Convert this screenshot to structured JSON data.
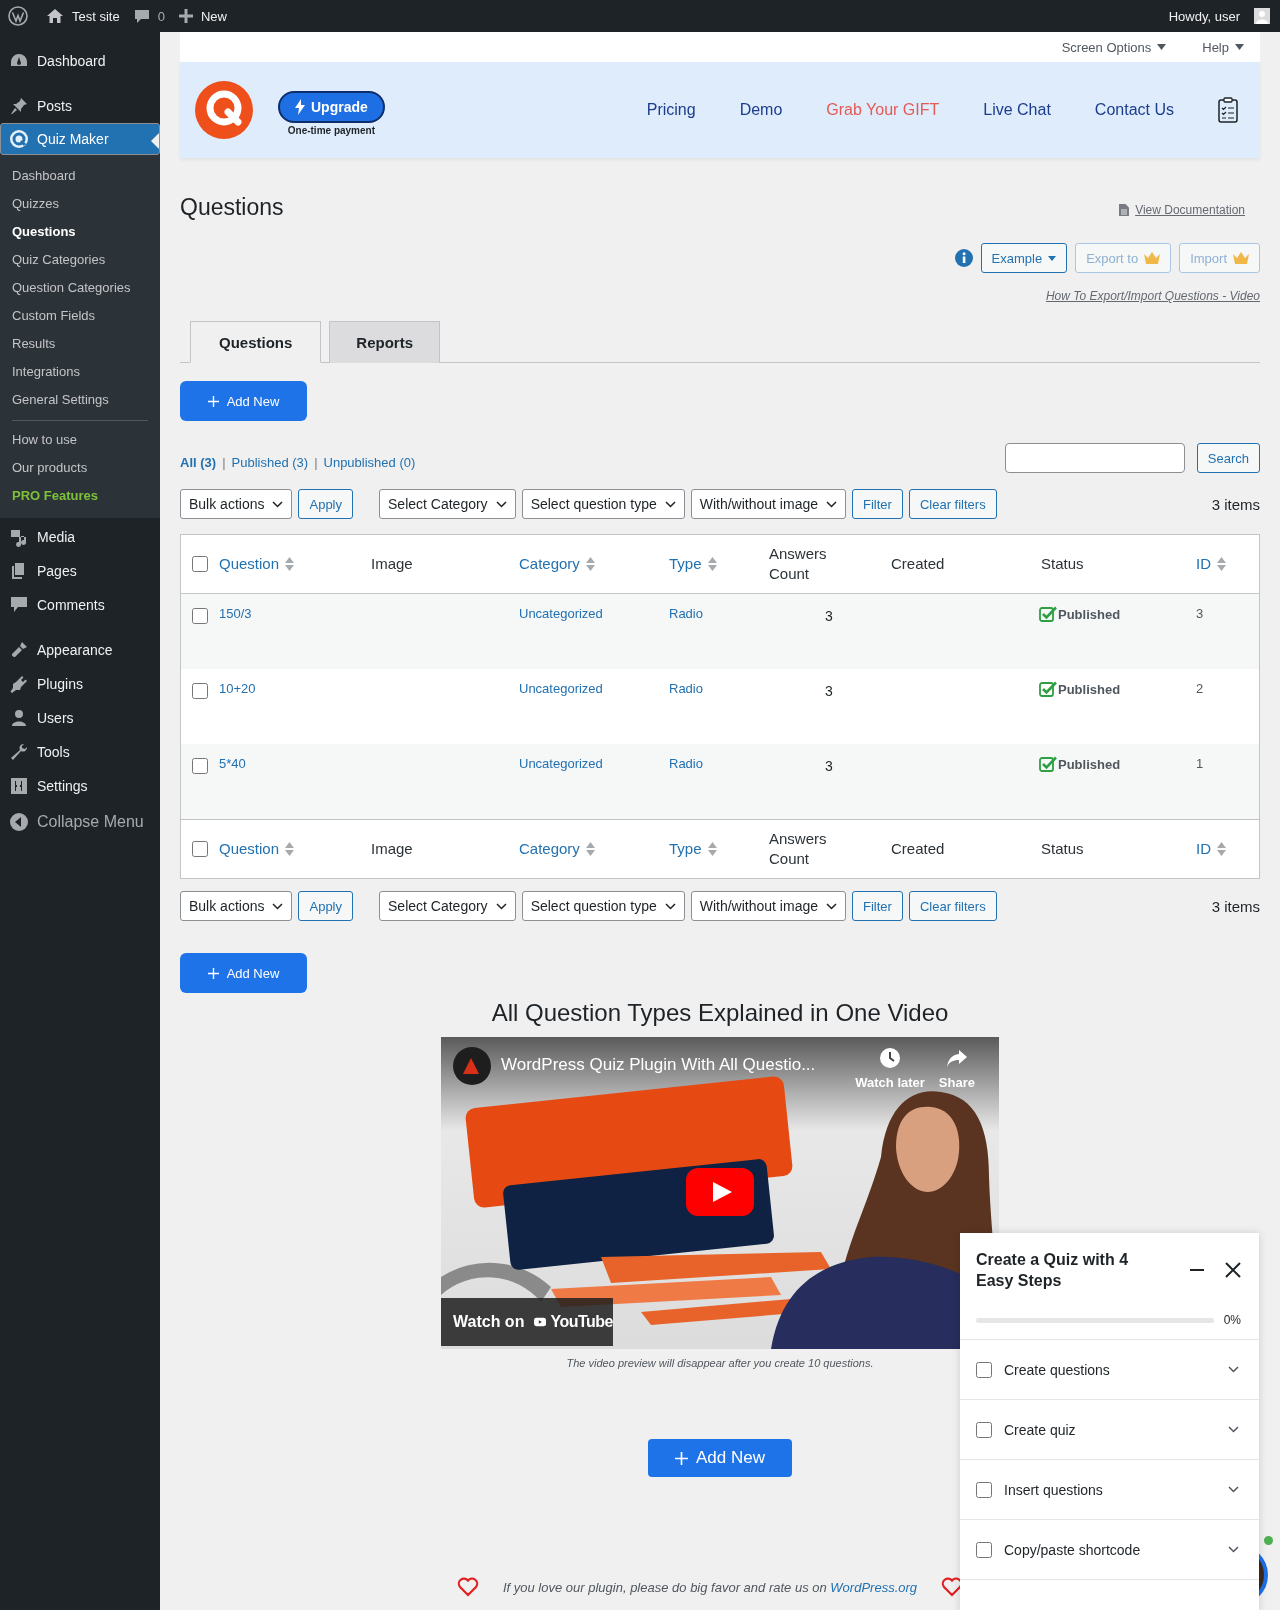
{
  "admin_bar": {
    "site": "Test site",
    "comments": "0",
    "new": "New",
    "greeting": "Howdy, user"
  },
  "sidebar": {
    "top": [
      {
        "label": "Dashboard",
        "selected": false
      },
      {
        "label": "Posts",
        "selected": false
      },
      {
        "label": "Quiz Maker",
        "selected": true
      }
    ],
    "submenu_groups": [
      {
        "items": [
          {
            "label": "Dashboard",
            "selected": false,
            "kind": "link"
          },
          {
            "label": "Quizzes",
            "selected": false,
            "kind": "link"
          },
          {
            "label": "Questions",
            "selected": true,
            "kind": "link"
          },
          {
            "label": "Quiz Categories",
            "selected": false,
            "kind": "link"
          },
          {
            "label": "Question Categories",
            "selected": false,
            "kind": "link"
          },
          {
            "label": "Custom Fields",
            "selected": false,
            "kind": "link"
          },
          {
            "label": "Results",
            "selected": false,
            "kind": "link"
          },
          {
            "label": "Integrations",
            "selected": false,
            "kind": "link"
          },
          {
            "label": "General Settings",
            "selected": false,
            "kind": "link"
          }
        ]
      },
      {
        "items": [
          {
            "label": "How to use",
            "selected": false,
            "kind": "link"
          },
          {
            "label": "Our products",
            "selected": false,
            "kind": "link"
          },
          {
            "label": "PRO Features",
            "selected": false,
            "kind": "pro"
          }
        ]
      }
    ],
    "bottom": [
      {
        "label": "Media",
        "selected": false
      },
      {
        "label": "Pages",
        "selected": false
      },
      {
        "label": "Comments",
        "selected": false
      },
      {
        "label": "Appearance",
        "selected": false
      },
      {
        "label": "Plugins",
        "selected": false
      },
      {
        "label": "Users",
        "selected": false
      },
      {
        "label": "Tools",
        "selected": false
      },
      {
        "label": "Settings",
        "selected": false
      }
    ],
    "collapse": "Collapse Menu"
  },
  "screen_meta": [
    "Screen Options",
    "Help"
  ],
  "banner": {
    "upgrade": "Upgrade",
    "upgrade_note": "One-time payment",
    "nav": [
      {
        "label": "Pricing",
        "kind": "normal"
      },
      {
        "label": "Demo",
        "kind": "normal"
      },
      {
        "label": "Grab Your GIFT",
        "kind": "promo"
      },
      {
        "label": "Live Chat",
        "kind": "normal"
      },
      {
        "label": "Contact Us",
        "kind": "normal"
      }
    ]
  },
  "page": {
    "title": "Questions",
    "doc_link": "View Documentation",
    "actions": [
      {
        "label": "Example",
        "kind": "dropdown"
      },
      {
        "label": "Export to",
        "kind": "pro"
      },
      {
        "label": "Import",
        "kind": "pro"
      }
    ],
    "video_link": "How To Export/Import Questions - Video"
  },
  "tabs": [
    {
      "label": "Questions",
      "selected": true
    },
    {
      "label": "Reports",
      "selected": false
    }
  ],
  "add_new_top": "Add New",
  "views": [
    {
      "label": "All (3)",
      "selected": true
    },
    {
      "separator": "|",
      "label": "Published (3)",
      "selected": false
    },
    {
      "separator": "|",
      "label": "Unpublished (0)",
      "selected": false
    }
  ],
  "search": {
    "button": "Search"
  },
  "toolbar_top": {
    "bulk": "Bulk actions",
    "apply": "Apply",
    "filters": [
      "Select Category",
      "Select question type",
      "With/without image"
    ],
    "filter": "Filter",
    "clear": "Clear filters",
    "count": "3 items"
  },
  "table": {
    "select_all_checked": false,
    "columns": [
      {
        "label": "Question",
        "sortable": true
      },
      {
        "label": "Image",
        "sortable": false
      },
      {
        "label": "Category",
        "sortable": true
      },
      {
        "label": "Type",
        "sortable": true
      },
      {
        "label": "Answers Count",
        "sortable": false
      },
      {
        "label": "Created",
        "sortable": false
      },
      {
        "label": "Status",
        "sortable": false
      },
      {
        "label": "ID",
        "sortable": true
      }
    ],
    "rows": [
      {
        "question": "150/3",
        "category": "Uncategorized",
        "type": "Radio",
        "answers": "3",
        "status": "Published",
        "id": "3",
        "checked": false
      },
      {
        "question": "10+20",
        "category": "Uncategorized",
        "type": "Radio",
        "answers": "3",
        "status": "Published",
        "id": "2",
        "checked": false
      },
      {
        "question": "5*40",
        "category": "Uncategorized",
        "type": "Radio",
        "answers": "3",
        "status": "Published",
        "id": "1",
        "checked": false
      }
    ],
    "footer_select_all_checked": false,
    "footer_columns": [
      {
        "label": "Question",
        "sortable": true
      },
      {
        "label": "Image",
        "sortable": false
      },
      {
        "label": "Category",
        "sortable": true
      },
      {
        "label": "Type",
        "sortable": true
      },
      {
        "label": "Answers Count",
        "sortable": false
      },
      {
        "label": "Created",
        "sortable": false
      },
      {
        "label": "Status",
        "sortable": false
      },
      {
        "label": "ID",
        "sortable": true
      }
    ]
  },
  "toolbar_bottom": {
    "bulk": "Bulk actions",
    "apply": "Apply",
    "filters": [
      "Select Category",
      "Select question type",
      "With/without image"
    ],
    "filter": "Filter",
    "clear": "Clear filters",
    "count": "3 items"
  },
  "add_new_bottom": "Add New",
  "video": {
    "heading": "All Question Types Explained in One Video",
    "title": "WordPress Quiz Plugin With All Questio...",
    "watch_later": "Watch later",
    "share": "Share",
    "watch_on": "Watch on",
    "youtube": "YouTube",
    "caption": "The video preview will disappear after you create 10 questions."
  },
  "add_new_large": "Add New",
  "footer": {
    "text": "If you love our plugin, please do big favor and rate us on",
    "link": "WordPress.org"
  },
  "widget": {
    "title": "Create a Quiz with 4 Easy Steps",
    "level": 0,
    "percent": "0%",
    "steps": [
      {
        "label": "Create questions",
        "checked": false
      },
      {
        "label": "Create quiz",
        "checked": false
      },
      {
        "label": "Insert questions",
        "checked": false
      },
      {
        "label": "Copy/paste shortcode",
        "checked": false
      }
    ]
  }
}
